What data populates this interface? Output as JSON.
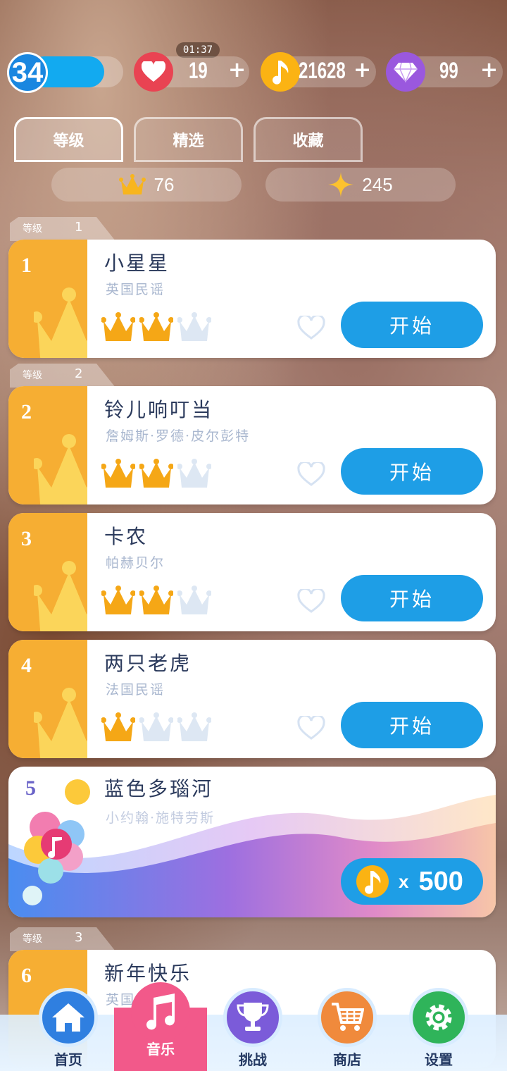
{
  "hud": {
    "level": "34",
    "level_progress": 0.8,
    "timer": "01:37",
    "lives": "19",
    "coins": "21628",
    "gems": "99",
    "plus": "+"
  },
  "tabs": [
    {
      "label": "等级",
      "active": true
    },
    {
      "label": "精选",
      "active": false
    },
    {
      "label": "收藏",
      "active": false
    }
  ],
  "stats": {
    "crowns": "76",
    "stars": "245"
  },
  "level_tags": [
    {
      "label": "等级",
      "num": "1"
    },
    {
      "label": "等级",
      "num": "2"
    },
    {
      "label": "等级",
      "num": "3"
    }
  ],
  "songs": [
    {
      "num": "1",
      "title": "小星星",
      "artist": "英国民谣",
      "crowns": 2,
      "button": "开始"
    },
    {
      "num": "2",
      "title": "铃儿响叮当",
      "artist": "詹姆斯·罗德·皮尔彭特",
      "crowns": 2,
      "button": "开始"
    },
    {
      "num": "3",
      "title": "卡农",
      "artist": "帕赫贝尔",
      "crowns": 2,
      "button": "开始"
    },
    {
      "num": "4",
      "title": "两只老虎",
      "artist": "法国民谣",
      "crowns": 1,
      "button": "开始"
    },
    {
      "num": "5",
      "title": "蓝色多瑙河",
      "artist": "小约翰·施特劳斯",
      "price_x": "x",
      "price": "500"
    },
    {
      "num": "6",
      "title": "新年快乐",
      "artist": "英国"
    }
  ],
  "nav": [
    {
      "label": "首页",
      "icon": "home-icon",
      "color": "#2f7fe0"
    },
    {
      "label": "音乐",
      "icon": "music-note-icon",
      "color": "#f2598a",
      "active": true
    },
    {
      "label": "挑战",
      "icon": "trophy-icon",
      "color": "#7b5bd9"
    },
    {
      "label": "商店",
      "icon": "cart-icon",
      "color": "#f08a3c"
    },
    {
      "label": "设置",
      "icon": "gear-icon",
      "color": "#2fb45a"
    }
  ]
}
